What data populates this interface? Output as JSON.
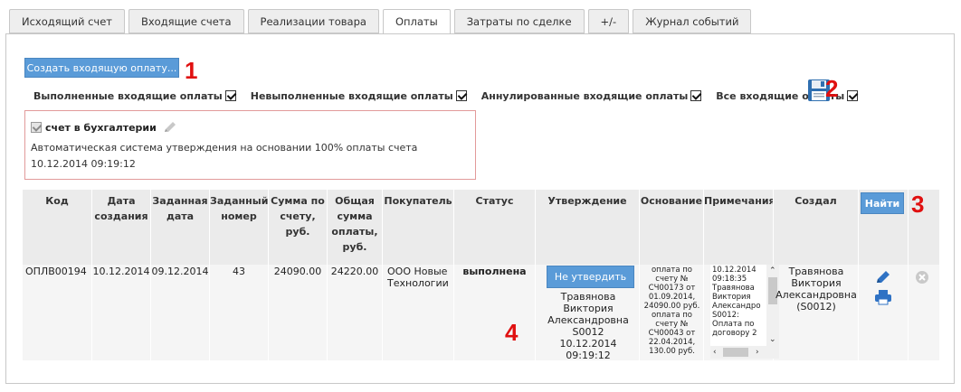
{
  "tabs": [
    {
      "label": "Исходящий счет"
    },
    {
      "label": "Входящие счета"
    },
    {
      "label": "Реализации товара"
    },
    {
      "label": "Оплаты"
    },
    {
      "label": "Затраты по сделке"
    },
    {
      "label": "+/-"
    },
    {
      "label": "Журнал событий"
    }
  ],
  "active_tab": "Оплаты",
  "create_button": "Создать входящую оплату...",
  "filters": [
    {
      "label": "Выполненные входящие оплаты",
      "checked": true
    },
    {
      "label": "Невыполненные входящие оплаты",
      "checked": true
    },
    {
      "label": "Аннулированные входящие оплаты",
      "checked": true
    },
    {
      "label": "Все входящие оплаты",
      "checked": true
    }
  ],
  "accounting": {
    "label": "счет в бухгалтерии",
    "checked": true,
    "description": "Автоматическая система утверждения на основании 100% оплаты счета 10.12.2014 09:19:12"
  },
  "annotations": [
    "1",
    "2",
    "3",
    "4"
  ],
  "table": {
    "headers": {
      "code": "Код",
      "created_date": "Дата создания",
      "set_date": "Заданная дата",
      "set_number": "Заданный номер",
      "invoice_sum": "Сумма по счету, руб.",
      "total_paid": "Общая сумма оплаты, руб.",
      "buyer": "Покупатель",
      "status": "Статус",
      "approval": "Утверждение",
      "basis": "Основание",
      "notes": "Примечания",
      "author": "Создал"
    },
    "find_button": "Найти",
    "row": {
      "code": "ОПЛВ00194",
      "created_date": "10.12.2014",
      "set_date": "09.12.2014",
      "set_number": "43",
      "invoice_sum": "24090.00",
      "total_paid": "24220.00",
      "buyer": "ООО Новые Технологии",
      "status": "выполнена",
      "approve_button": "Не утвердить",
      "approval_text": "Травянова Виктория Александровна S0012 10.12.2014 09:19:12",
      "basis": "оплата по счету № СЧ00173 от 01.09.2014, 24090.00 руб. оплата по счету № СЧ00043 от 22.04.2014, 130.00 руб.",
      "notes": "10.12.2014 09:18:35 Травянова Виктория Александро S0012: Оплата по договору 2",
      "author": "Травянова Виктория Александровна (S0012)"
    }
  }
}
